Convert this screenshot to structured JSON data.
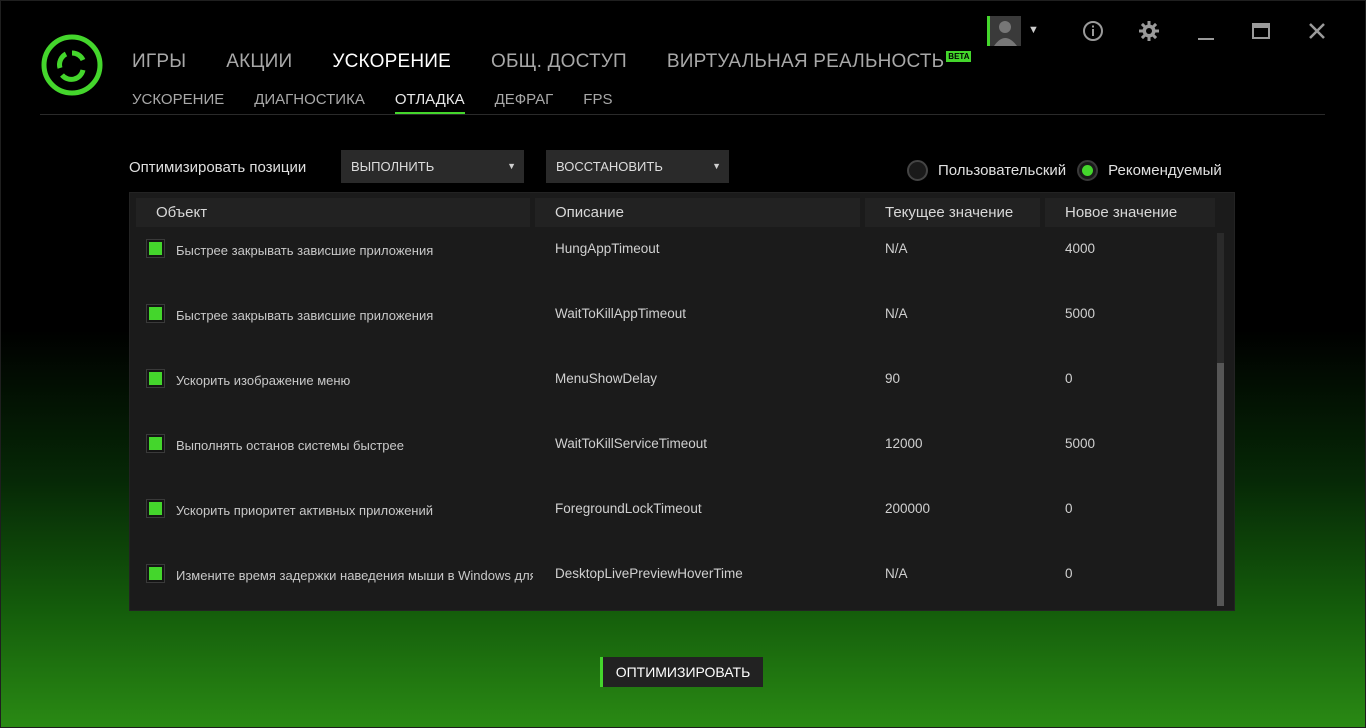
{
  "colors": {
    "accent": "#44d62c",
    "background": "#000000",
    "panel": "#1b1b1b"
  },
  "logo": {
    "icon": "razer-cortex-logo-icon"
  },
  "main_nav": [
    {
      "label": "ИГРЫ",
      "active": false
    },
    {
      "label": "АКЦИИ",
      "active": false
    },
    {
      "label": "УСКОРЕНИЕ",
      "active": true
    },
    {
      "label": "ОБЩ. ДОСТУП",
      "active": false
    },
    {
      "label": "ВИРТУАЛЬНАЯ РЕАЛЬНОСТЬ",
      "active": false,
      "badge": "BETA"
    }
  ],
  "sub_nav": [
    {
      "label": "УСКОРЕНИЕ",
      "active": false
    },
    {
      "label": "ДИАГНОСТИКА",
      "active": false
    },
    {
      "label": "ОТЛАДКА",
      "active": true
    },
    {
      "label": "ДЕФРАГ",
      "active": false
    },
    {
      "label": "FPS",
      "active": false
    }
  ],
  "window_controls": {
    "avatar": "user-avatar-icon",
    "info": "info-icon",
    "settings": "gear-icon",
    "minimize": "minimize-icon",
    "maximize": "maximize-icon",
    "close": "close-icon"
  },
  "toolbar": {
    "label": "Оптимизировать позиции",
    "execute_dropdown": "ВЫПОЛНИТЬ",
    "restore_dropdown": "ВОССТАНОВИТЬ",
    "radio_custom": "Пользовательский",
    "radio_recommended": "Рекомендуемый",
    "selected": "recommended"
  },
  "table": {
    "headers": [
      "Объект",
      "Описание",
      "Текущее значение",
      "Новое значение"
    ],
    "rows": [
      {
        "checked": true,
        "object": "Быстрее закрывать зависшие приложения",
        "description": "HungAppTimeout",
        "current": "N/A",
        "new": "4000"
      },
      {
        "checked": true,
        "object": "Быстрее закрывать зависшие приложения",
        "description": "WaitToKillAppTimeout",
        "current": "N/A",
        "new": "5000"
      },
      {
        "checked": true,
        "object": "Ускорить изображение меню",
        "description": "MenuShowDelay",
        "current": "90",
        "new": "0"
      },
      {
        "checked": true,
        "object": "Выполнять останов системы быстрее",
        "description": "WaitToKillServiceTimeout",
        "current": "12000",
        "new": "5000"
      },
      {
        "checked": true,
        "object": "Ускорить приоритет активных приложений",
        "description": "ForegroundLockTimeout",
        "current": "200000",
        "new": "0"
      },
      {
        "checked": true,
        "object": "Измените время задержки наведения мыши в Windows для",
        "description": "DesktopLivePreviewHoverTime",
        "current": "N/A",
        "new": "0"
      }
    ]
  },
  "optimize_button": "ОПТИМИЗИРОВАТЬ"
}
